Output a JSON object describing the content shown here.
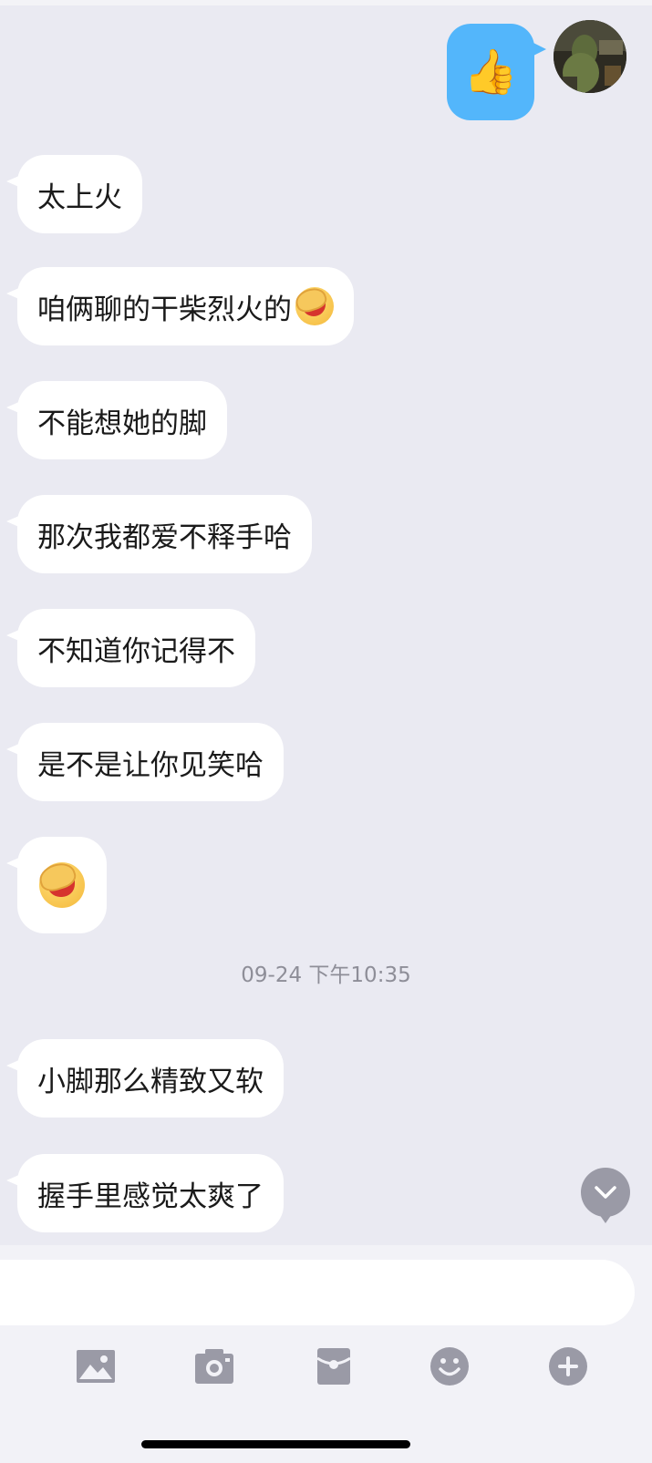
{
  "conversation": {
    "outgoing": [
      {
        "kind": "emoji",
        "icon": "thumbs-up-icon",
        "glyph": "👍"
      }
    ],
    "incoming_before": [
      {
        "text": "太上火"
      },
      {
        "text": "咱俩聊的干柴烈火的",
        "trailing_icon": "facepalm-emoji-icon"
      },
      {
        "text": "不能想她的脚"
      },
      {
        "text": "那次我都爱不释手哈"
      },
      {
        "text": "不知道你记得不"
      },
      {
        "text": "是不是让你见笑哈"
      },
      {
        "text": "",
        "icon": "facepalm-emoji-icon"
      }
    ],
    "timestamp": "09-24 下午10:35",
    "incoming_after": [
      {
        "text": "小脚那么精致又软"
      },
      {
        "text": "握手里感觉太爽了"
      }
    ]
  },
  "input": {
    "value": "",
    "placeholder": ""
  },
  "toolbar": {
    "items": [
      "image-icon",
      "camera-icon",
      "red-packet-icon",
      "emoji-smile-icon",
      "plus-icon"
    ]
  },
  "colors": {
    "background": "#eaeaf2",
    "outgoing_bubble": "#53b6fb",
    "incoming_bubble": "#ffffff",
    "icon_gray": "#9a9aa6"
  }
}
